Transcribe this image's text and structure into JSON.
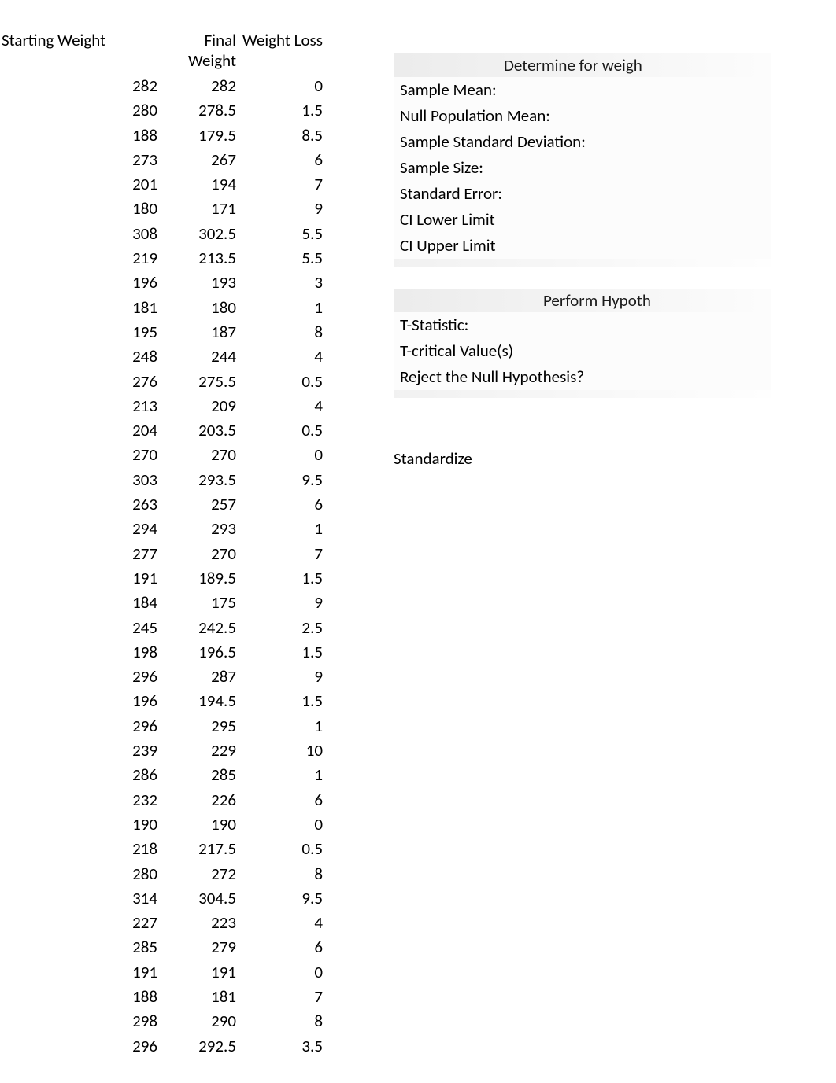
{
  "table": {
    "headers": {
      "start": "Starting Weight",
      "final": "Final Weight",
      "loss": "Weight Loss"
    },
    "rows": [
      {
        "start": 282,
        "final": "282",
        "loss": "0"
      },
      {
        "start": 280,
        "final": "278.5",
        "loss": "1.5"
      },
      {
        "start": 188,
        "final": "179.5",
        "loss": "8.5"
      },
      {
        "start": 273,
        "final": "267",
        "loss": "6"
      },
      {
        "start": 201,
        "final": "194",
        "loss": "7"
      },
      {
        "start": 180,
        "final": "171",
        "loss": "9"
      },
      {
        "start": 308,
        "final": "302.5",
        "loss": "5.5"
      },
      {
        "start": 219,
        "final": "213.5",
        "loss": "5.5"
      },
      {
        "start": 196,
        "final": "193",
        "loss": "3"
      },
      {
        "start": 181,
        "final": "180",
        "loss": "1"
      },
      {
        "start": 195,
        "final": "187",
        "loss": "8"
      },
      {
        "start": 248,
        "final": "244",
        "loss": "4"
      },
      {
        "start": 276,
        "final": "275.5",
        "loss": "0.5"
      },
      {
        "start": 213,
        "final": "209",
        "loss": "4"
      },
      {
        "start": 204,
        "final": "203.5",
        "loss": "0.5"
      },
      {
        "start": 270,
        "final": "270",
        "loss": "0"
      },
      {
        "start": 303,
        "final": "293.5",
        "loss": "9.5"
      },
      {
        "start": 263,
        "final": "257",
        "loss": "6"
      },
      {
        "start": 294,
        "final": "293",
        "loss": "1"
      },
      {
        "start": 277,
        "final": "270",
        "loss": "7"
      },
      {
        "start": 191,
        "final": "189.5",
        "loss": "1.5"
      },
      {
        "start": 184,
        "final": "175",
        "loss": "9"
      },
      {
        "start": 245,
        "final": "242.5",
        "loss": "2.5"
      },
      {
        "start": 198,
        "final": "196.5",
        "loss": "1.5"
      },
      {
        "start": 296,
        "final": "287",
        "loss": "9"
      },
      {
        "start": 196,
        "final": "194.5",
        "loss": "1.5"
      },
      {
        "start": 296,
        "final": "295",
        "loss": "1"
      },
      {
        "start": 239,
        "final": "229",
        "loss": "10"
      },
      {
        "start": 286,
        "final": "285",
        "loss": "1"
      },
      {
        "start": 232,
        "final": "226",
        "loss": "6"
      },
      {
        "start": 190,
        "final": "190",
        "loss": "0"
      },
      {
        "start": 218,
        "final": "217.5",
        "loss": "0.5"
      },
      {
        "start": 280,
        "final": "272",
        "loss": "8"
      },
      {
        "start": 314,
        "final": "304.5",
        "loss": "9.5"
      },
      {
        "start": 227,
        "final": "223",
        "loss": "4"
      },
      {
        "start": 285,
        "final": "279",
        "loss": "6"
      },
      {
        "start": 191,
        "final": "191",
        "loss": "0"
      },
      {
        "start": 188,
        "final": "181",
        "loss": "7"
      },
      {
        "start": 298,
        "final": "290",
        "loss": "8"
      },
      {
        "start": 296,
        "final": "292.5",
        "loss": "3.5"
      }
    ]
  },
  "section1": {
    "title": "Determine for weigh",
    "rows": [
      "Sample Mean:",
      "Null Population Mean:",
      "Sample Standard Deviation:",
      "Sample Size:",
      "Standard Error:",
      "CI Lower Limit",
      "CI Upper Limit"
    ]
  },
  "section2": {
    "title": "Perform Hypoth",
    "rows": [
      "T-Statistic:",
      "T-critical Value(s)",
      "Reject the Null Hypothesis?"
    ]
  },
  "standardize_label": "Standardize"
}
